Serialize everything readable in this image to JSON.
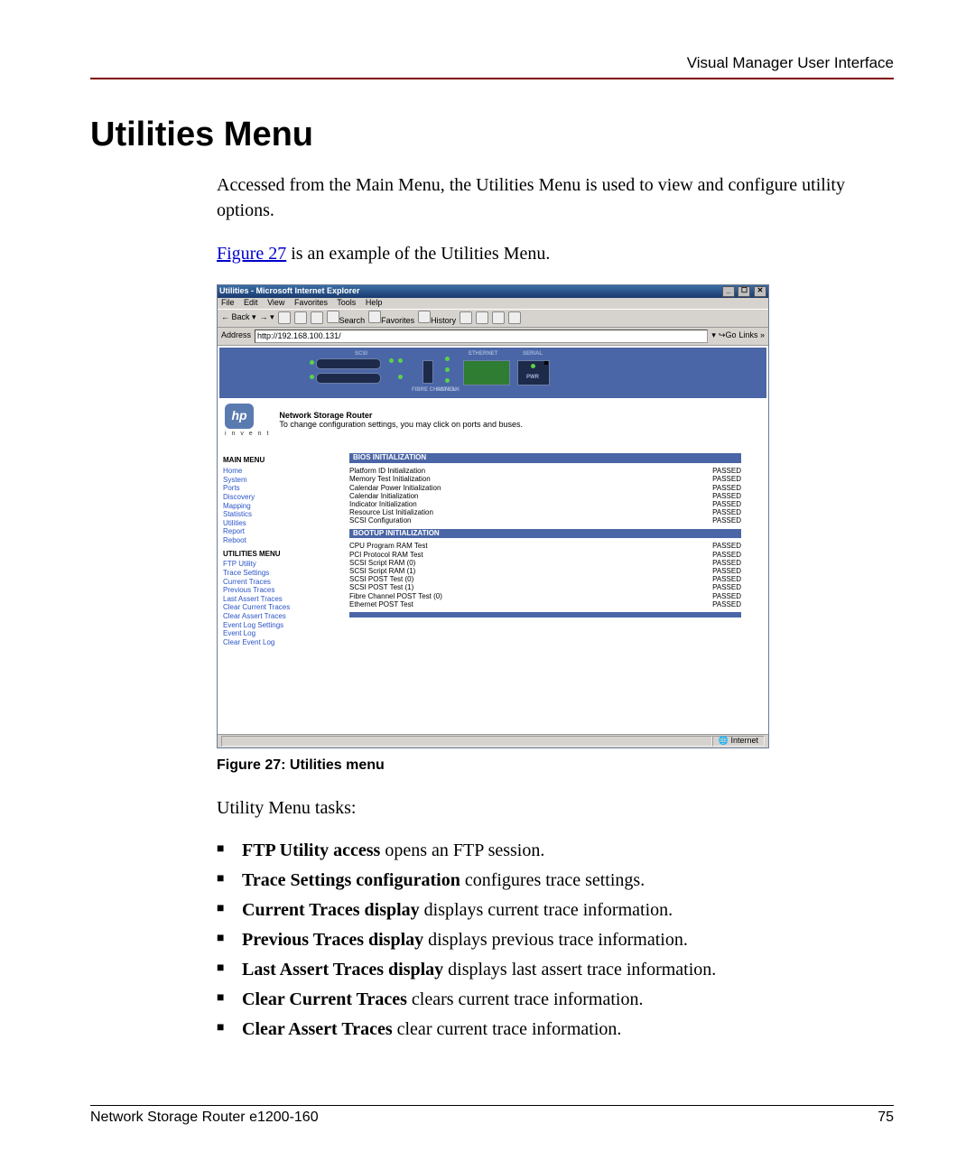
{
  "header": {
    "right": "Visual Manager User Interface"
  },
  "title": "Utilities Menu",
  "intro": {
    "p1": "Accessed from the Main Menu, the Utilities Menu is used to view and configure utility options.",
    "fig_link": "Figure 27",
    "p2_tail": " is an example of the Utilities Menu."
  },
  "browser": {
    "title": "Utilities - Microsoft Internet Explorer",
    "menus": [
      "File",
      "Edit",
      "View",
      "Favorites",
      "Tools",
      "Help"
    ],
    "toolbar": {
      "back": "Back",
      "search": "Search",
      "favorites": "Favorites",
      "history": "History"
    },
    "address_label": "Address",
    "address": "http://192.168.100.131/",
    "go": "Go",
    "links": "Links",
    "status_left": "",
    "status_right": "Internet"
  },
  "device": {
    "scsi": "SCSI",
    "fibre": "FIBRE CHANNEL",
    "act": "ACT/LNK",
    "ethernet": "ETHERNET",
    "serial": "SERIAL",
    "pwr": "PWR"
  },
  "banner": {
    "logo_text": "hp",
    "invent": "i n v e n t",
    "line1": "Network Storage Router",
    "line2": "To change configuration settings, you may click on ports and buses."
  },
  "sidebar": {
    "main_title": "MAIN MENU",
    "main": [
      "Home",
      "System",
      "Ports",
      "Discovery",
      "Mapping",
      "Statistics",
      "Utilities",
      "Report",
      "Reboot"
    ],
    "util_title": "UTILITIES MENU",
    "util": [
      "FTP Utility",
      "Trace Settings",
      "Current Traces",
      "Previous Traces",
      "Last Assert Traces",
      "Clear Current Traces",
      "Clear Assert Traces",
      "Event Log Settings",
      "Event Log",
      "Clear Event Log"
    ]
  },
  "sections": {
    "bios_title": "BIOS INITIALIZATION",
    "bios": [
      {
        "label": "Platform ID Initialization",
        "status": "PASSED"
      },
      {
        "label": "Memory Test Initialization",
        "status": "PASSED"
      },
      {
        "label": "Calendar Power Initialization",
        "status": "PASSED"
      },
      {
        "label": "Calendar Initialization",
        "status": "PASSED"
      },
      {
        "label": "Indicator Initialization",
        "status": "PASSED"
      },
      {
        "label": "Resource List Initialization",
        "status": "PASSED"
      },
      {
        "label": "SCSI Configuration",
        "status": "PASSED"
      }
    ],
    "boot_title": "BOOTUP INITIALIZATION",
    "boot": [
      {
        "label": "CPU Program RAM Test",
        "status": "PASSED"
      },
      {
        "label": "PCI Protocol RAM Test",
        "status": "PASSED"
      },
      {
        "label": "SCSI Script RAM (0)",
        "status": "PASSED"
      },
      {
        "label": "SCSI Script RAM (1)",
        "status": "PASSED"
      },
      {
        "label": "SCSI POST Test (0)",
        "status": "PASSED"
      },
      {
        "label": "SCSI POST Test (1)",
        "status": "PASSED"
      },
      {
        "label": "Fibre Channel POST Test (0)",
        "status": "PASSED"
      },
      {
        "label": "Ethernet POST Test",
        "status": "PASSED"
      }
    ]
  },
  "caption": "Figure 27:  Utilities menu",
  "tasks_intro": "Utility Menu tasks:",
  "tasks": [
    {
      "bold": "FTP Utility access",
      "rest": " opens an FTP session."
    },
    {
      "bold": "Trace Settings configuration",
      "rest": " configures trace settings."
    },
    {
      "bold": "Current Traces display",
      "rest": " displays current trace information."
    },
    {
      "bold": "Previous Traces display",
      "rest": " displays previous trace information."
    },
    {
      "bold": "Last Assert Traces display",
      "rest": " displays last assert trace information."
    },
    {
      "bold": "Clear Current Traces",
      "rest": " clears current trace information."
    },
    {
      "bold": "Clear Assert Traces",
      "rest": " clear current trace information."
    }
  ],
  "footer": {
    "left": "Network Storage Router e1200-160",
    "right": "75"
  }
}
